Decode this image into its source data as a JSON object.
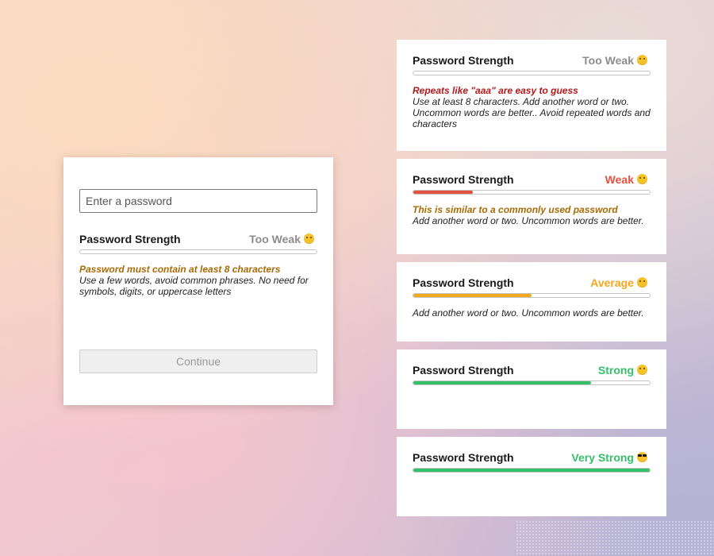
{
  "colors": {
    "too_weak": "#8c8c8c",
    "weak": "#e2523f",
    "average": "#f0a81c",
    "strong": "#34c06b",
    "warning_orange": "#a86a05",
    "warning_red": "#b4181b"
  },
  "main": {
    "password_placeholder": "Enter a password",
    "password_value": "",
    "strength_title": "Password Strength",
    "strength_level": "Too Weak",
    "strength_emoji": "laughing-emoji",
    "strength_fraction": 0,
    "warning": "Password must contain at least 8 characters",
    "suggestion": "Use a few words, avoid common phrases. No need for symbols, digits, or uppercase letters",
    "continue_label": "Continue"
  },
  "cards": [
    {
      "title": "Password Strength",
      "level": "Too Weak",
      "emoji": "laughing-emoji",
      "strength_fraction": 0,
      "warning": "Repeats like \"aaa\" are easy to guess",
      "suggestion": "Use at least 8 characters. Add another word or two. Uncommon words are better.. Avoid repeated words and characters"
    },
    {
      "title": "Password Strength",
      "level": "Weak",
      "emoji": "frowning-emoji",
      "strength_fraction": 0.25,
      "warning": "This is similar to a commonly used password",
      "suggestion": "Add another word or two. Uncommon words are better."
    },
    {
      "title": "Password Strength",
      "level": "Average",
      "emoji": "neutral-emoji",
      "strength_fraction": 0.5,
      "warning": "",
      "suggestion": "Add another word or two. Uncommon words are better."
    },
    {
      "title": "Password Strength",
      "level": "Strong",
      "emoji": "smiling-emoji",
      "strength_fraction": 0.75,
      "warning": "",
      "suggestion": ""
    },
    {
      "title": "Password Strength",
      "level": "Very Strong",
      "emoji": "sunglasses-emoji",
      "strength_fraction": 1,
      "warning": "",
      "suggestion": ""
    }
  ]
}
